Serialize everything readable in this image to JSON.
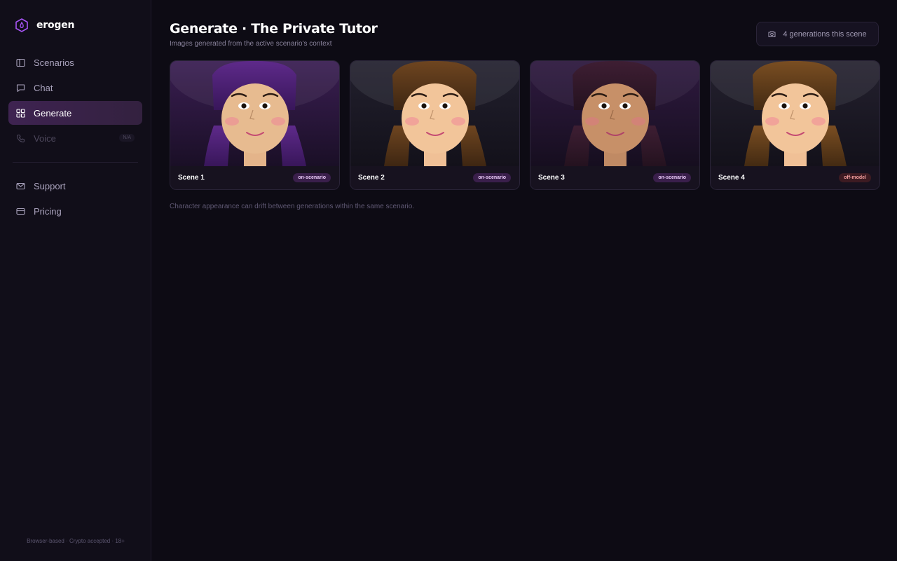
{
  "brand": {
    "name": "erogen",
    "logo_icon": "hexagon-logo-icon",
    "accent": "#a855f7"
  },
  "nav": {
    "items": [
      {
        "label": "Scenarios",
        "icon": "book-icon",
        "active": false
      },
      {
        "label": "Chat",
        "icon": "chat-bubble-icon",
        "active": false
      },
      {
        "label": "Generate",
        "icon": "grid-icon",
        "active": true
      },
      {
        "label": "Voice",
        "icon": "phone-icon",
        "disabled": true,
        "badge": "N/A"
      }
    ],
    "secondary": [
      {
        "label": "Support",
        "icon": "mail-icon"
      },
      {
        "label": "Pricing",
        "icon": "credit-card-icon"
      }
    ]
  },
  "footer": {
    "text": "Browser-based · Crypto accepted · 18+"
  },
  "header": {
    "title": "Generate · The Private Tutor",
    "subtitle": "Images generated from the active scenario's context",
    "generations_label": "4 generations this scene",
    "generations_icon": "camera-icon"
  },
  "cards": [
    {
      "label": "Scene 1",
      "badge": "on-scenario",
      "status": "on"
    },
    {
      "label": "Scene 2",
      "badge": "on-scenario",
      "status": "on"
    },
    {
      "label": "Scene 3",
      "badge": "on-scenario",
      "status": "on"
    },
    {
      "label": "Scene 4",
      "badge": "off-model",
      "status": "off"
    }
  ],
  "note": "Character appearance can drift between generations within the same scenario."
}
